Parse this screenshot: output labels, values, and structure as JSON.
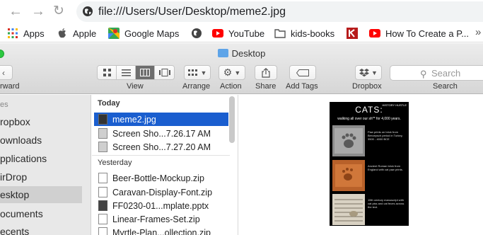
{
  "browser": {
    "url": "file:///Users/User/Desktop/meme2.jpg"
  },
  "bookmarks": [
    {
      "label": "Apps",
      "icon": "apps-grid-icon"
    },
    {
      "label": "Apple",
      "icon": "apple-icon"
    },
    {
      "label": "Google Maps",
      "icon": "google-maps-icon"
    },
    {
      "label": "",
      "icon": "globe-icon"
    },
    {
      "label": "YouTube",
      "icon": "youtube-icon"
    },
    {
      "label": "kids-books",
      "icon": "folder-icon"
    },
    {
      "label": "",
      "icon": "k-logo-icon"
    },
    {
      "label": "How To Create a P...",
      "icon": "youtube-icon"
    }
  ],
  "finder": {
    "title": "Desktop",
    "toolbar": {
      "back_label": "rward",
      "view_label": "View",
      "arrange_label": "Arrange",
      "action_label": "Action",
      "share_label": "Share",
      "add_tags_label": "Add Tags",
      "dropbox_label": "Dropbox",
      "search_label": "Search",
      "search_placeholder": "Search"
    },
    "sidebar": {
      "header": "es",
      "items": [
        {
          "label": "ropbox",
          "selected": false
        },
        {
          "label": "ownloads",
          "selected": false
        },
        {
          "label": "pplications",
          "selected": false
        },
        {
          "label": "irDrop",
          "selected": false
        },
        {
          "label": "esktop",
          "selected": true
        },
        {
          "label": "ocuments",
          "selected": false
        },
        {
          "label": "ecents",
          "selected": false
        }
      ]
    },
    "list": {
      "groups": [
        {
          "label": "Today",
          "files": [
            {
              "name": "meme2.jpg",
              "kind": "img",
              "selected": true
            },
            {
              "name": "Screen Sho...7.26.17 AM",
              "kind": "shot",
              "selected": false
            },
            {
              "name": "Screen Sho...7.27.20 AM",
              "kind": "shot",
              "selected": false
            }
          ]
        },
        {
          "label": "Yesterday",
          "files": [
            {
              "name": "Beer-Bottle-Mockup.zip",
              "kind": "zip",
              "selected": false
            },
            {
              "name": "Caravan-Display-Font.zip",
              "kind": "zip",
              "selected": false
            },
            {
              "name": "FF0230-01...mplate.pptx",
              "kind": "ppt",
              "selected": false
            },
            {
              "name": "Linear-Frames-Set.zip",
              "kind": "zip",
              "selected": false
            },
            {
              "name": "Myrtle-Plan...ollection.zip",
              "kind": "zip",
              "selected": false
            }
          ]
        }
      ]
    },
    "preview": {
      "meme_title": "CATS:",
      "meme_subtitle": "walking all over our sh** for 4,000 years.",
      "meme_logo": "HISTORY HUSTLE",
      "captions": [
        "Paw prints on brick from Beroepsch period in Turkey, 3500 - 4000 BCE",
        "Ancient Roman brick from England with cat paw prints.",
        "15th century manuscript with cat piss and cat feces across the text."
      ]
    }
  }
}
